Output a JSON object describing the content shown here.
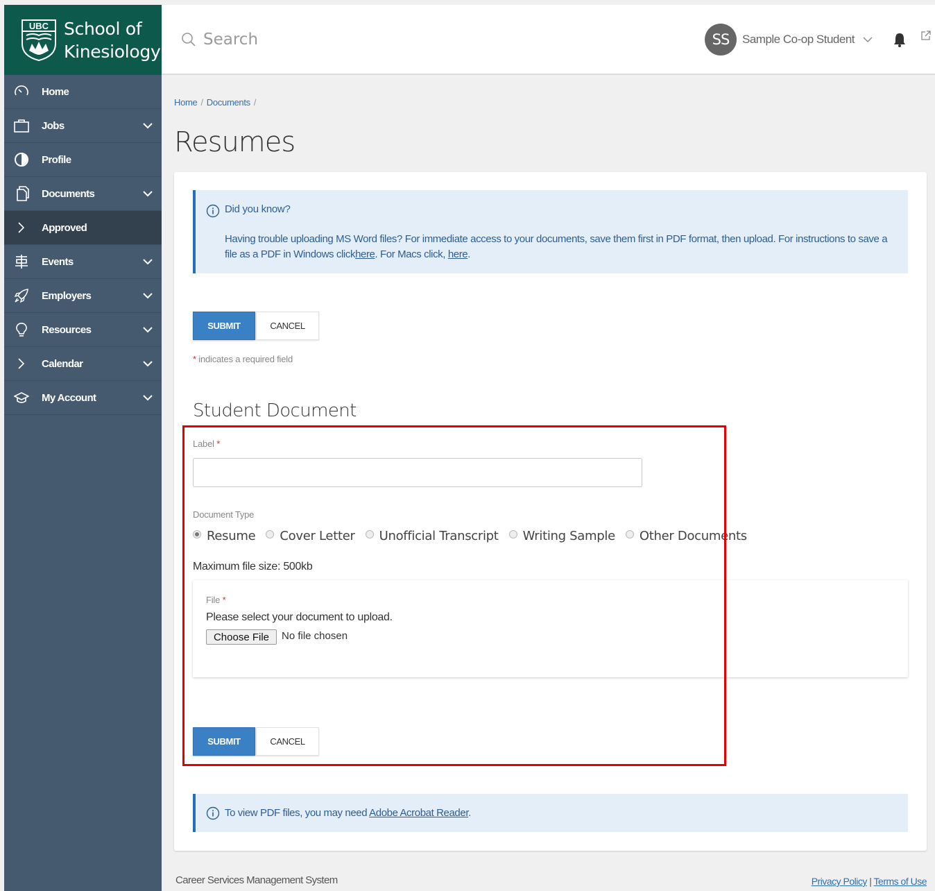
{
  "brand": {
    "logo_mark": "UBC",
    "line1": "School of",
    "line2": "Kinesiology",
    "green": "#0d5a4c",
    "sidebar_bg": "#455a6e"
  },
  "sidebar": {
    "items": [
      {
        "label": "Home",
        "icon": "dashboard-icon",
        "chevron": false
      },
      {
        "label": "Jobs",
        "icon": "briefcase-icon",
        "chevron": true
      },
      {
        "label": "Profile",
        "icon": "profile-icon",
        "chevron": false
      },
      {
        "label": "Documents",
        "icon": "documents-icon",
        "chevron": true
      },
      {
        "label": "Approved",
        "icon": "chevron-right-icon",
        "chevron": false,
        "sub": true
      },
      {
        "label": "Events",
        "icon": "events-icon",
        "chevron": true
      },
      {
        "label": "Employers",
        "icon": "rocket-icon",
        "chevron": true
      },
      {
        "label": "Resources",
        "icon": "lightbulb-icon",
        "chevron": true
      },
      {
        "label": "Calendar",
        "icon": "chevron-right-icon",
        "chevron": true
      },
      {
        "label": "My Account",
        "icon": "graduation-cap-icon",
        "chevron": true
      }
    ]
  },
  "header": {
    "search_placeholder": "Search",
    "avatar_initials": "SS",
    "user_name": "Sample Co-op Student"
  },
  "breadcrumb": {
    "home": "Home",
    "documents": "Documents",
    "sep": "/"
  },
  "page": {
    "title": "Resumes"
  },
  "info_top": {
    "title": "Did you know?",
    "text_part1": "Having trouble uploading MS Word files? For immediate access to your documents, save them first in PDF format, then upload. For instructions to save a file as a PDF in Windows click",
    "link1": "here",
    "text_part2": ". For Macs click, ",
    "link2": "here",
    "text_part3": "."
  },
  "buttons": {
    "submit": "SUBMIT",
    "cancel": "CANCEL"
  },
  "required_note": {
    "star": "*",
    "text": " indicates a required field"
  },
  "form": {
    "section_title": "Student Document",
    "label_field": "Label",
    "star": "*",
    "label_value": "",
    "doc_type_label": "Document Type",
    "doc_types": [
      {
        "label": "Resume",
        "checked": true
      },
      {
        "label": "Cover Letter",
        "checked": false
      },
      {
        "label": "Unofficial Transcript",
        "checked": false
      },
      {
        "label": "Writing Sample",
        "checked": false
      },
      {
        "label": "Other Documents",
        "checked": false
      }
    ],
    "max_size": "Maximum file size: 500kb",
    "file_label": "File",
    "file_hint": "Please select your document to upload.",
    "choose_file": "Choose File",
    "no_file": "No file chosen"
  },
  "info_bottom": {
    "text": "To view PDF files, you may need ",
    "link": "Adobe Acrobat Reader",
    "end": "."
  },
  "footer": {
    "left": "Career Services Management System",
    "privacy": "Privacy Policy",
    "divider": " | ",
    "terms": "Terms of Use"
  },
  "colors": {
    "primary": "#3a80c4",
    "info_bg": "#e3eef9",
    "highlight": "#e50000"
  }
}
